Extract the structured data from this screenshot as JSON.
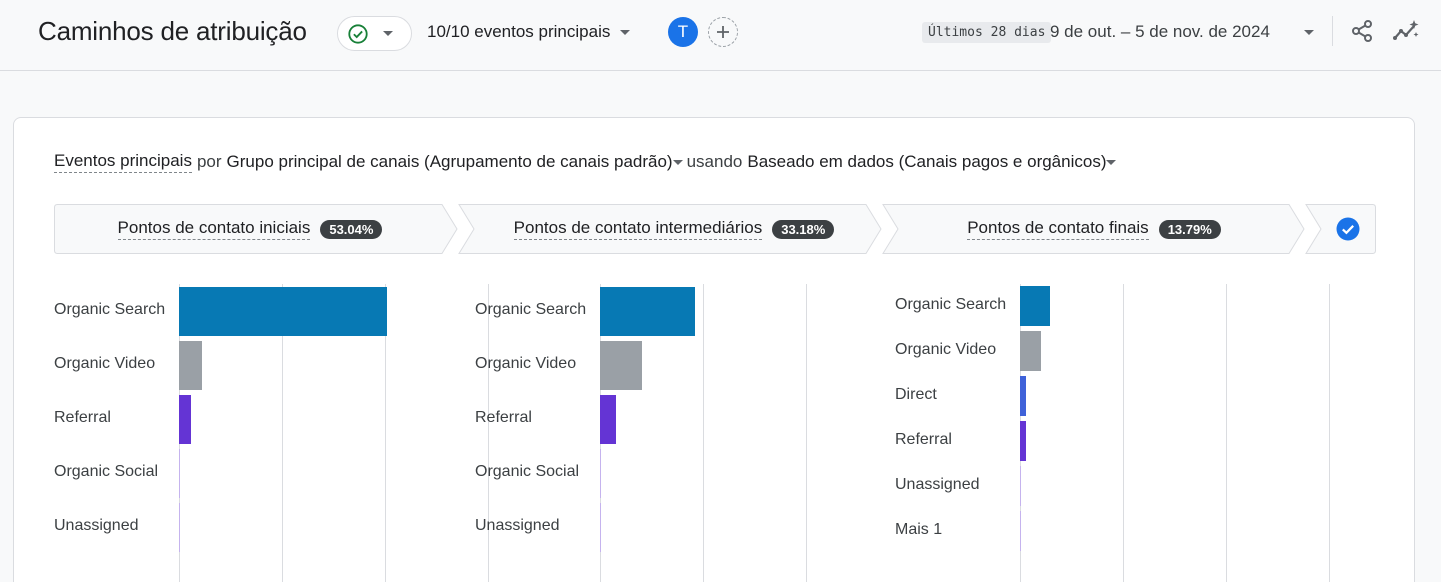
{
  "header": {
    "title": "Caminhos de atribuição",
    "events_select": "10/10 eventos principais",
    "avatar_letter": "T",
    "date_preset": "Últimos 28 dias",
    "date_range": "9 de out. – 5 de nov. de 2024"
  },
  "filter": {
    "metric": "Eventos principais",
    "by": "por",
    "dimension": "Grupo principal de canais (Agrupamento de canais padrão)",
    "using": "usando",
    "model": "Baseado em dados (Canais pagos e orgânicos)"
  },
  "steps": [
    {
      "label": "Pontos de contato iniciais",
      "percent": "53.04%"
    },
    {
      "label": "Pontos de contato intermediários",
      "percent": "33.18%"
    },
    {
      "label": "Pontos de contato finais",
      "percent": "13.79%"
    }
  ],
  "colors": {
    "organic_search": "#0779b4",
    "organic_video": "#9aa0a6",
    "referral": "#6434d4",
    "direct": "#3f62d9",
    "accent": "#1a73e8"
  },
  "chart_data": [
    {
      "type": "bar",
      "orientation": "horizontal",
      "categories": [
        "Organic Search",
        "Organic Video",
        "Referral",
        "Organic Social",
        "Unassigned"
      ],
      "values": [
        2.02,
        0.22,
        0.12,
        0.01,
        0.005
      ],
      "xlim": [
        0,
        3
      ],
      "grid": true
    },
    {
      "type": "bar",
      "orientation": "horizontal",
      "categories": [
        "Organic Search",
        "Organic Video",
        "Referral",
        "Organic Social",
        "Unassigned"
      ],
      "values": [
        0.92,
        0.41,
        0.16,
        0.01,
        0.005
      ],
      "xlim": [
        0,
        2
      ],
      "grid": true
    },
    {
      "type": "bar",
      "orientation": "horizontal",
      "categories": [
        "Organic Search",
        "Organic Video",
        "Direct",
        "Referral",
        "Unassigned",
        "Mais 1"
      ],
      "values": [
        0.29,
        0.2,
        0.06,
        0.06,
        0.005,
        0.005
      ],
      "xlim": [
        0,
        3
      ],
      "grid": true
    }
  ]
}
